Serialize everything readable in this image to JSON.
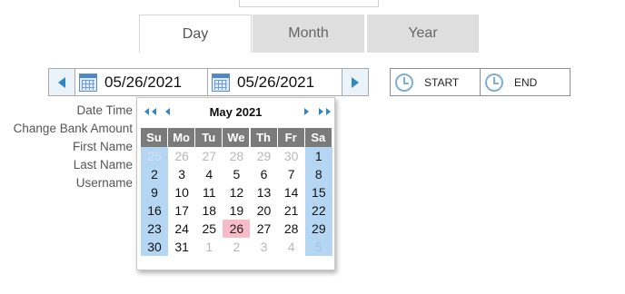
{
  "tabs": [
    {
      "label": "Day",
      "active": true
    },
    {
      "label": "Month",
      "active": false
    },
    {
      "label": "Year",
      "active": false
    }
  ],
  "date_range": {
    "start_date": "05/26/2021",
    "end_date": "05/26/2021"
  },
  "time_buttons": {
    "start_label": "START",
    "end_label": "END"
  },
  "form_labels": [
    "Date Time",
    "Change Bank Amount",
    "First Name",
    "Last Name",
    "Username"
  ],
  "calendar": {
    "title": "May 2021",
    "weekdays": [
      "Su",
      "Mo",
      "Tu",
      "We",
      "Th",
      "Fr",
      "Sa"
    ],
    "weeks": [
      [
        "25",
        "26",
        "27",
        "28",
        "29",
        "30",
        "1"
      ],
      [
        "2",
        "3",
        "4",
        "5",
        "6",
        "7",
        "8"
      ],
      [
        "9",
        "10",
        "11",
        "12",
        "13",
        "14",
        "15"
      ],
      [
        "16",
        "17",
        "18",
        "19",
        "20",
        "21",
        "22"
      ],
      [
        "23",
        "24",
        "25",
        "26",
        "27",
        "28",
        "29"
      ],
      [
        "30",
        "31",
        "1",
        "2",
        "3",
        "4",
        "5"
      ]
    ],
    "selected_day": "26"
  },
  "colors": {
    "accent": "#2e86c9",
    "weekend_highlight": "#b5d6f3",
    "selected_highlight": "#f7bcc8",
    "header_bg": "#7b7b7b"
  }
}
